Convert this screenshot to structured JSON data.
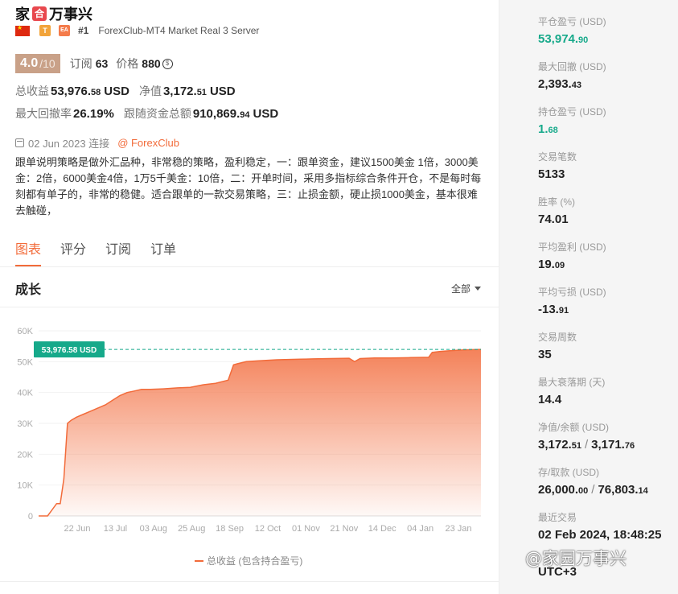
{
  "header": {
    "title_pre": "家",
    "title_logo": "合",
    "title_post": "万事兴",
    "badge_t": "T",
    "badge_ea": "EA",
    "rank": "#1",
    "server": "ForexClub-MT4 Market Real 3 Server"
  },
  "rating": {
    "score": "4.0",
    "scale": "/10",
    "subs_label": "订阅",
    "subs_value": "63",
    "price_label": "价格",
    "price_value": "880",
    "price_icon": "coin-icon"
  },
  "stats": {
    "total_profit_label": "总收益",
    "total_profit_big": "53,976.",
    "total_profit_small": "58",
    "total_profit_cur": "USD",
    "equity_label": "净值",
    "equity_big": "3,172.",
    "equity_small": "51",
    "equity_cur": "USD",
    "max_dd_label": "最大回撤率",
    "max_dd_value": "26.19%",
    "follow_label": "跟随资金总额",
    "follow_big": "910,869.",
    "follow_small": "94",
    "follow_cur": "USD"
  },
  "info": {
    "date": "02 Jun 2023 连接",
    "broker": "@ ForexClub",
    "description": "跟单说明策略是做外汇品种，非常稳的策略，盈利稳定，一：跟单资金，建议1500美金 1倍，3000美金：2倍，6000美金4倍，1万5千美金：10倍，二：开单时间，采用多指标综合条件开仓，不是每时每刻都有单子的，非常的稳健。适合跟单的一款交易策略，三：止损金额，硬止损1000美金，基本很难去触碰，"
  },
  "tabs": [
    "图表",
    "评分",
    "订阅",
    "订单"
  ],
  "growth": {
    "title": "成长",
    "filter": "全部",
    "legend": "总收益 (包含持合盈亏)"
  },
  "chart_data": {
    "type": "area",
    "x_ticks": [
      "22 Jun",
      "13 Jul",
      "03 Aug",
      "25 Aug",
      "18 Sep",
      "12 Oct",
      "01 Nov",
      "21 Nov",
      "14 Dec",
      "04 Jan",
      "23 Jan"
    ],
    "y_ticks": [
      "0",
      "10K",
      "20K",
      "30K",
      "40K",
      "50K",
      "60K"
    ],
    "ylim": [
      0,
      60000
    ],
    "current_label": "53,976.58 USD",
    "current_value": 53976.58,
    "x": [
      "2023-06-02",
      "2023-06-07",
      "2023-06-12",
      "2023-06-14",
      "2023-06-16",
      "2023-06-18",
      "2023-06-20",
      "2023-06-23",
      "2023-06-27",
      "2023-07-01",
      "2023-07-05",
      "2023-07-09",
      "2023-07-13",
      "2023-07-17",
      "2023-07-21",
      "2023-07-25",
      "2023-07-29",
      "2023-08-03",
      "2023-08-10",
      "2023-08-18",
      "2023-08-25",
      "2023-09-01",
      "2023-09-08",
      "2023-09-15",
      "2023-09-18",
      "2023-09-20",
      "2023-09-25",
      "2023-10-02",
      "2023-10-12",
      "2023-10-25",
      "2023-11-01",
      "2023-11-10",
      "2023-11-21",
      "2023-11-24",
      "2023-11-27",
      "2023-12-05",
      "2023-12-14",
      "2023-12-25",
      "2024-01-01",
      "2024-01-04",
      "2024-01-06",
      "2024-01-10",
      "2024-01-15",
      "2024-01-23",
      "2024-02-02"
    ],
    "values": [
      0,
      0,
      4000,
      4000,
      12000,
      30000,
      31000,
      32000,
      33000,
      34000,
      35000,
      36000,
      37500,
      39000,
      40000,
      40500,
      41000,
      41000,
      41200,
      41500,
      41700,
      42500,
      43000,
      44000,
      49000,
      49300,
      50000,
      50300,
      50600,
      50800,
      50900,
      51000,
      51100,
      50000,
      51000,
      51200,
      51200,
      51300,
      51400,
      51400,
      53000,
      53300,
      53500,
      53800,
      53976.58
    ]
  },
  "side": {
    "items": [
      {
        "label": "平仓盈亏 (USD)",
        "big": "53,974.",
        "small": "90",
        "green": true
      },
      {
        "label": "最大回撤 (USD)",
        "big": "2,393.",
        "small": "43",
        "green": false
      },
      {
        "label": "持仓盈亏 (USD)",
        "big": "1.",
        "small": "68",
        "green": true
      },
      {
        "label": "交易笔数",
        "big": "5133",
        "small": "",
        "green": false
      },
      {
        "label": "胜率 (%)",
        "big": "74.01",
        "small": "",
        "green": false
      },
      {
        "label": "平均盈利 (USD)",
        "big": "19.",
        "small": "09",
        "green": false
      },
      {
        "label": "平均亏损 (USD)",
        "big": "-13.",
        "small": "91",
        "green": false
      },
      {
        "label": "交易周数",
        "big": "35",
        "small": "",
        "green": false
      },
      {
        "label": "最大衰落期 (天)",
        "big": "14.4",
        "small": "",
        "green": false
      }
    ],
    "equity_balance_label": "净值/余额 (USD)",
    "equity_big": "3,172.",
    "equity_small": "51",
    "balance_big": "3,171.",
    "balance_small": "76",
    "deposit_label": "存/取款 (USD)",
    "deposit_big": "26,000.",
    "deposit_small": "00",
    "withdraw_big": "76,803.",
    "withdraw_small": "14",
    "last_trade_label": "最近交易",
    "last_trade_value": "02 Feb 2024, 18:48:25",
    "timezone_value": "UTC+3",
    "slash": "/"
  },
  "watermark": "@家园万事兴"
}
